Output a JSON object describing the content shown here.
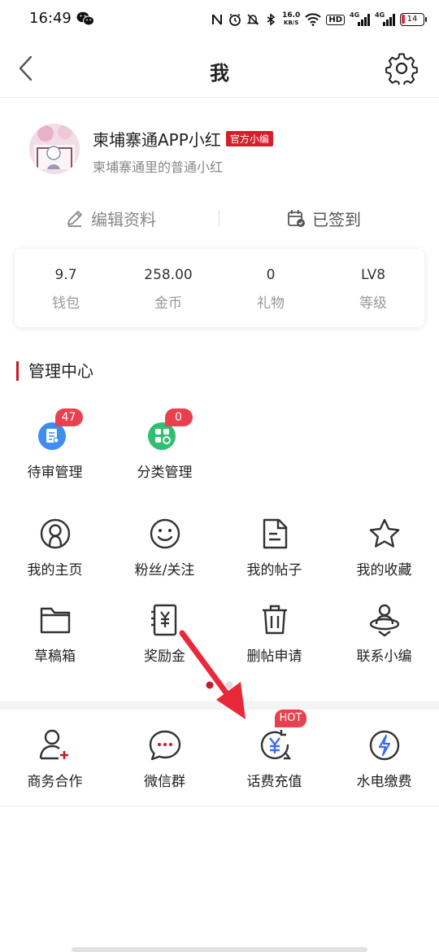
{
  "status_bar": {
    "time": "16:49",
    "net_speed_value": "16.0",
    "net_speed_unit": "KB/S",
    "hd": "HD",
    "signal_1": "4G",
    "signal_2": "4G",
    "battery": "14"
  },
  "header": {
    "title": "我",
    "back_icon": "chevron-left-icon",
    "settings_icon": "gear-icon"
  },
  "profile": {
    "name": "柬埔寨通APP小红",
    "badge": "官方小编",
    "signature": "柬埔寨通里的普通小红"
  },
  "actions": {
    "edit": "编辑资料",
    "signin": "已签到"
  },
  "stats": [
    {
      "value": "9.7",
      "label": "钱包"
    },
    {
      "value": "258.00",
      "label": "金币"
    },
    {
      "value": "0",
      "label": "礼物"
    },
    {
      "value": "LV8",
      "label": "等级"
    }
  ],
  "management": {
    "title": "管理中心",
    "items": [
      {
        "label": "待审管理",
        "count": "47",
        "icon": "review-doc-icon",
        "color": "#3d8ef0"
      },
      {
        "label": "分类管理",
        "count": "0",
        "icon": "category-grid-icon",
        "color": "#2fbf71"
      }
    ]
  },
  "menu": [
    {
      "label": "我的主页",
      "icon": "user-circle-icon"
    },
    {
      "label": "粉丝/关注",
      "icon": "smile-icon"
    },
    {
      "label": "我的帖子",
      "icon": "document-icon"
    },
    {
      "label": "我的收藏",
      "icon": "star-icon"
    },
    {
      "label": "草稿箱",
      "icon": "folder-icon"
    },
    {
      "label": "奖励金",
      "icon": "yuan-note-icon"
    },
    {
      "label": "删帖申请",
      "icon": "trash-icon"
    },
    {
      "label": "联系小编",
      "icon": "contact-user-icon"
    }
  ],
  "services": [
    {
      "label": "商务合作",
      "icon": "user-add-icon"
    },
    {
      "label": "微信群",
      "icon": "chat-bubble-icon"
    },
    {
      "label": "话费充值",
      "icon": "recharge-icon",
      "badge": "HOT"
    },
    {
      "label": "水电缴费",
      "icon": "lightning-icon"
    }
  ],
  "colors": {
    "accent": "#c8192a",
    "badge": "#e8404e",
    "muted": "#888888"
  }
}
